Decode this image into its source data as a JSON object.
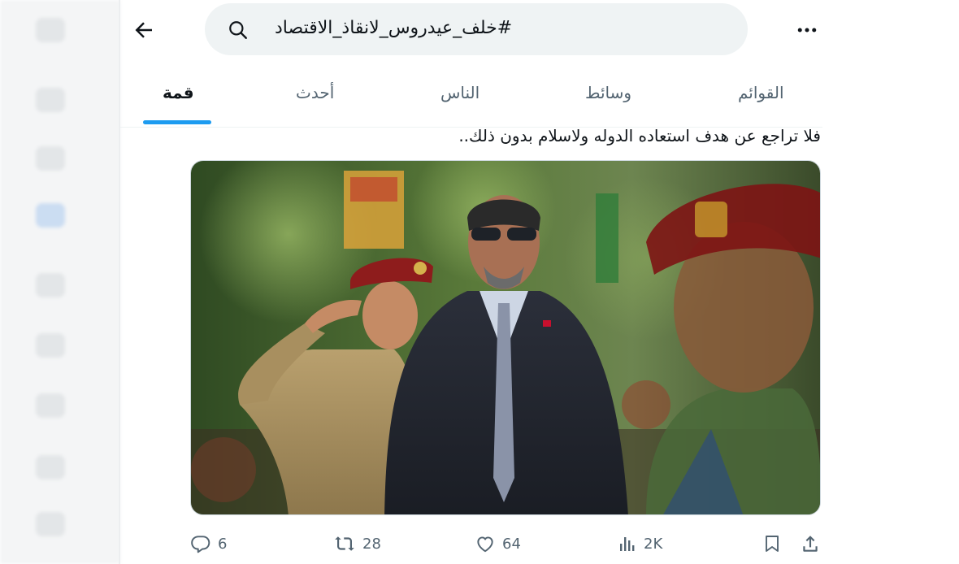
{
  "header": {
    "search_query": "#خلف_عيدروس_لانقاذ_الاقتصاد"
  },
  "tabs": [
    {
      "label": "قمة",
      "active": true
    },
    {
      "label": "أحدث",
      "active": false
    },
    {
      "label": "الناس",
      "active": false
    },
    {
      "label": "وسائط",
      "active": false
    },
    {
      "label": "القوائم",
      "active": false
    }
  ],
  "tweet": {
    "text": "فلا تراجع عن هدف استعاده الدوله ولاسلام بدون ذلك..",
    "media_description": "photo",
    "stats": {
      "replies": "6",
      "reposts": "28",
      "likes": "64",
      "views": "2K"
    }
  },
  "colors": {
    "accent": "#1d9bf0",
    "muted": "#536471",
    "text": "#0f1419",
    "search_bg": "#eff3f4"
  },
  "icons": [
    "back-arrow-icon",
    "search-icon",
    "more-icon",
    "reply-icon",
    "repost-icon",
    "like-icon",
    "views-icon",
    "bookmark-icon",
    "share-icon"
  ]
}
